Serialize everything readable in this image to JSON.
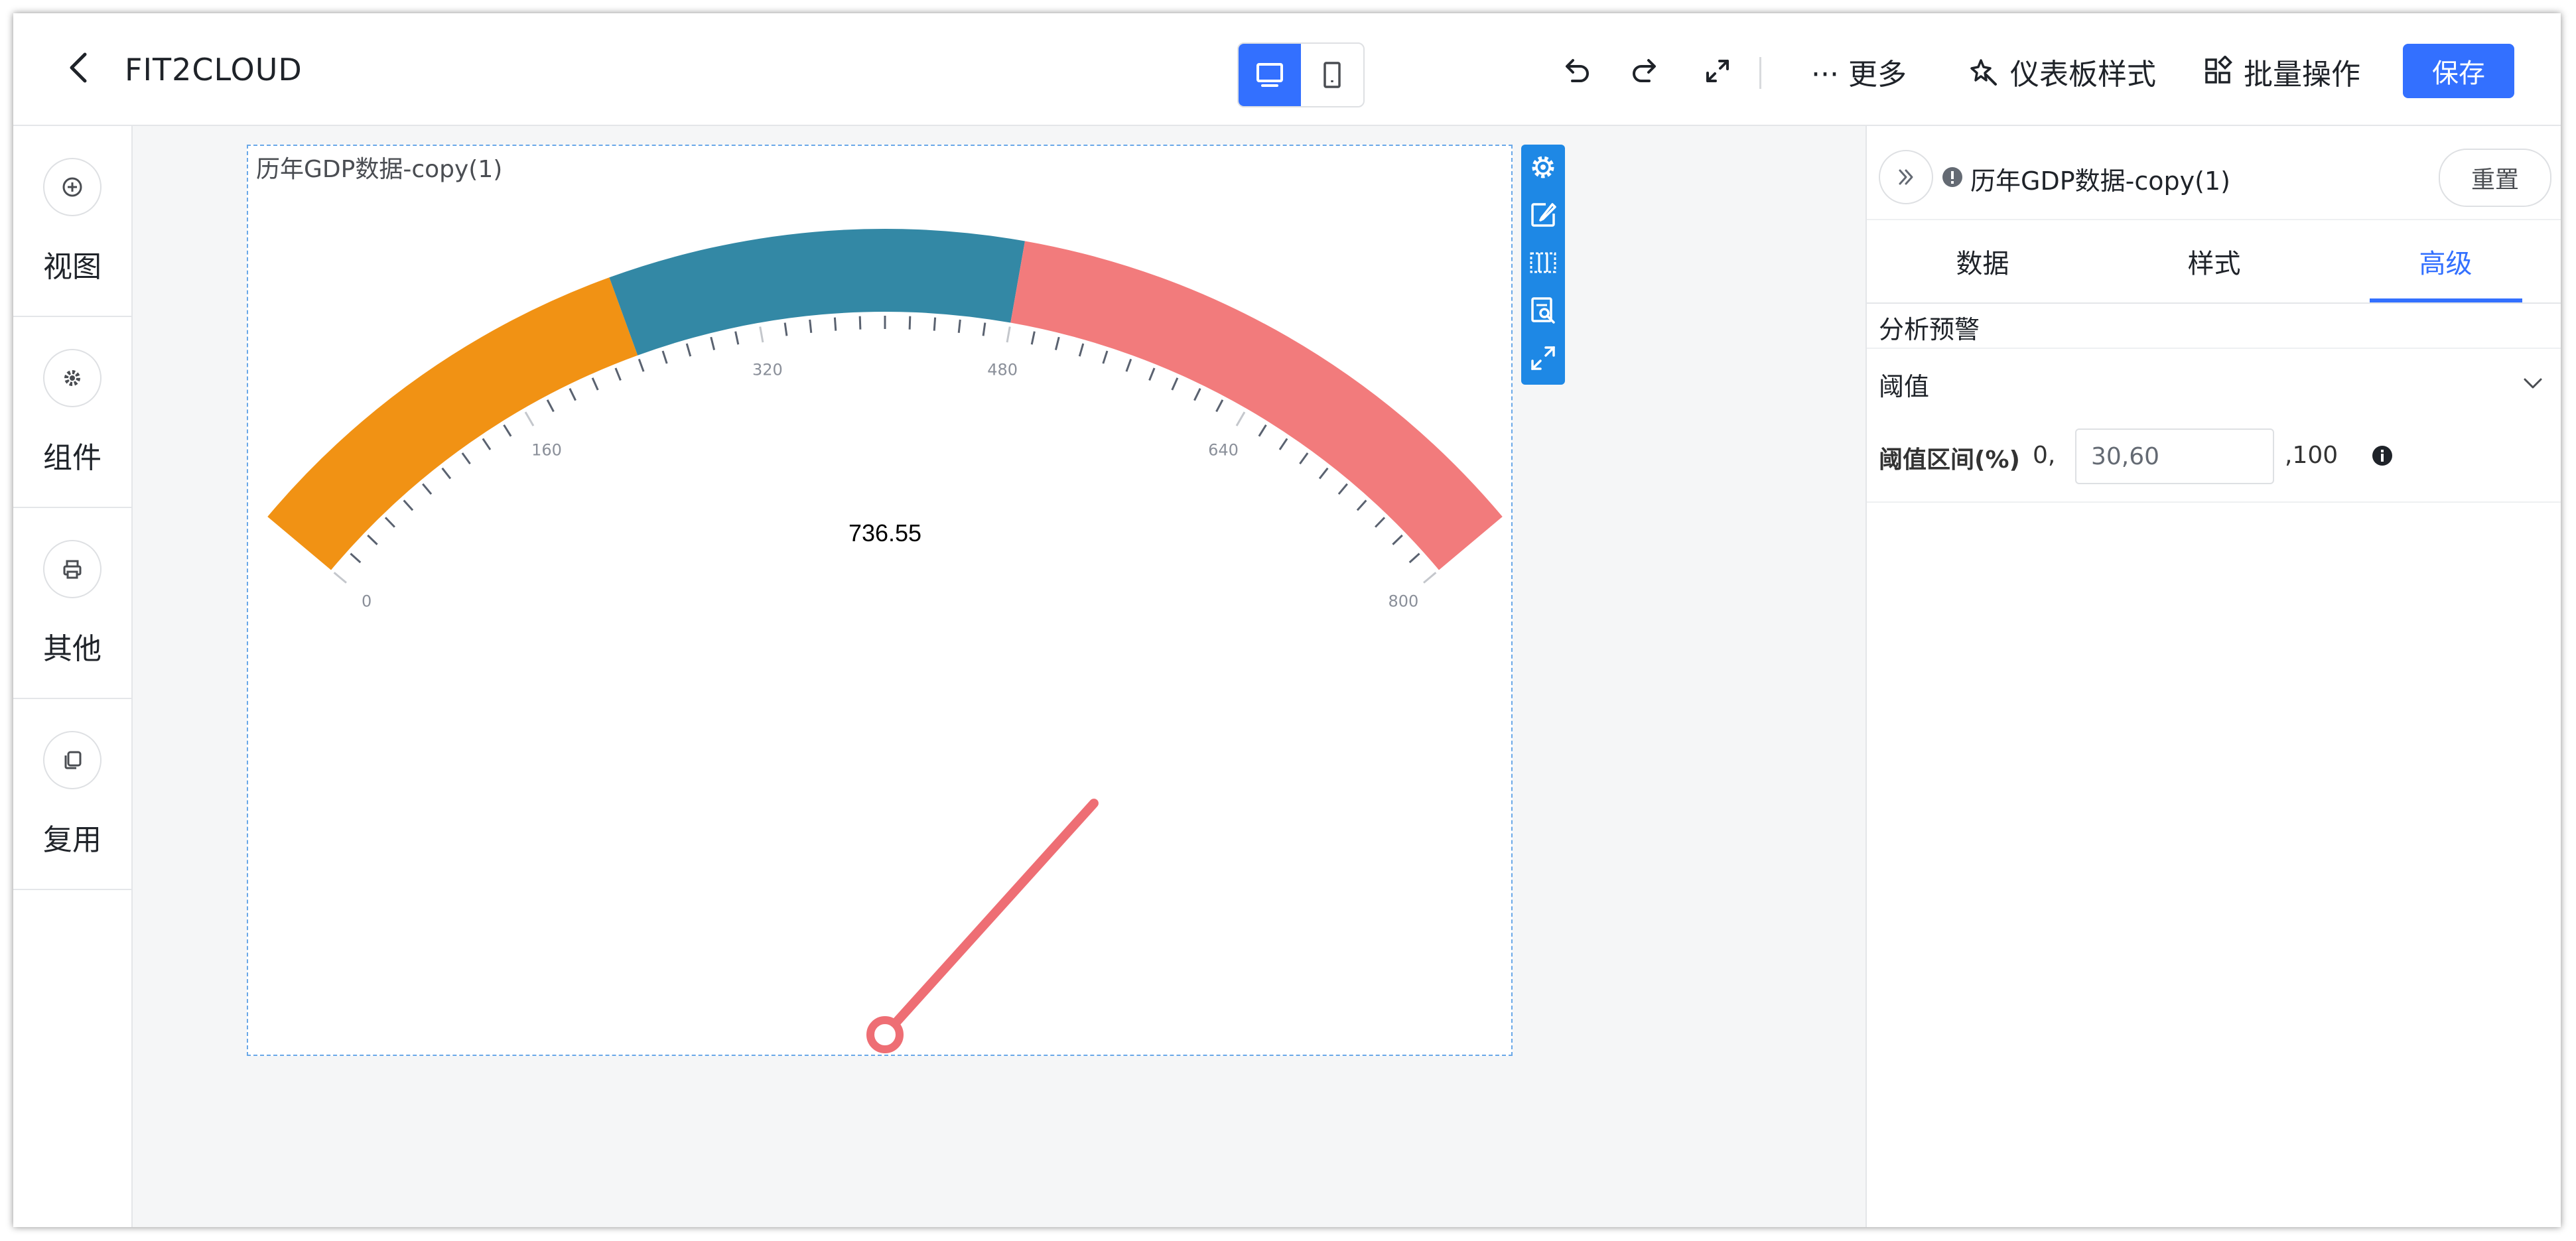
{
  "header": {
    "title": "FIT2CLOUD",
    "more_label": "··· 更多",
    "dashboard_style_label": "仪表板样式",
    "batch_label": "批量操作",
    "save_label": "保存"
  },
  "sidebar": {
    "items": [
      {
        "label": "视图",
        "icon": "plus-circle-icon"
      },
      {
        "label": "组件",
        "icon": "gear-icon"
      },
      {
        "label": "其他",
        "icon": "printer-icon"
      },
      {
        "label": "复用",
        "icon": "copy-icon"
      }
    ]
  },
  "chart": {
    "title": "历年GDP数据-copy(1)"
  },
  "chart_data": {
    "type": "gauge",
    "min": 0,
    "max": 800,
    "value": 736.55,
    "value_label": "736.55",
    "tick_labels": [
      "0",
      "160",
      "320",
      "480",
      "640",
      "800"
    ],
    "ticks": [
      0,
      160,
      320,
      480,
      640,
      800
    ],
    "bands": [
      {
        "from": 0,
        "to": 240,
        "color": "#f19214"
      },
      {
        "from": 240,
        "to": 480,
        "color": "#3388a5"
      },
      {
        "from": 480,
        "to": 800,
        "color": "#f27b7c"
      }
    ],
    "pointer_color": "#ee6e74"
  },
  "panel": {
    "chart_name": "历年GDP数据-copy(1)",
    "reset_label": "重置",
    "tabs": [
      {
        "label": "数据",
        "active": false
      },
      {
        "label": "样式",
        "active": false
      },
      {
        "label": "高级",
        "active": true
      }
    ],
    "section_title": "分析预警",
    "threshold_title": "阈值",
    "threshold_range_label": "阈值区间(%)",
    "threshold_prefix": "0,",
    "threshold_value": "30,60",
    "threshold_suffix": ",100"
  }
}
